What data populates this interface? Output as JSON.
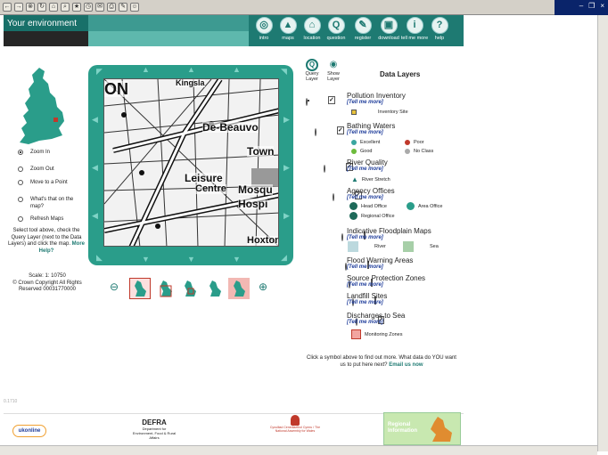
{
  "header": {
    "title": "Your environment"
  },
  "nav": [
    {
      "label": "intro",
      "icon": "intro-icon",
      "glyph": "◎"
    },
    {
      "label": "maps",
      "icon": "maps-icon",
      "glyph": "▲"
    },
    {
      "label": "location",
      "icon": "location-icon",
      "glyph": "⌂"
    },
    {
      "label": "question",
      "icon": "question-icon",
      "glyph": "Q"
    },
    {
      "label": "register",
      "icon": "register-icon",
      "glyph": "✎"
    },
    {
      "label": "download",
      "icon": "download-icon",
      "glyph": "▣"
    },
    {
      "label": "tell me more",
      "icon": "info-icon",
      "glyph": "i"
    },
    {
      "label": "help",
      "icon": "help-icon",
      "glyph": "?"
    }
  ],
  "tools": [
    {
      "label": "Zoom In",
      "selected": true
    },
    {
      "label": "Zoom Out",
      "selected": false
    },
    {
      "label": "Move to a Point",
      "selected": false
    },
    {
      "label": "What's that on the map?",
      "selected": false
    },
    {
      "label": "Refresh Maps",
      "selected": false
    }
  ],
  "hint": {
    "text": "Select tool above, check the Query Layer (next to the Data Layers) and click the map.",
    "link": "More Help?"
  },
  "scale": {
    "label": "Scale: 1: 10750",
    "copyright": "© Crown Copyright All Rights Reserved 00031770000"
  },
  "map": {
    "labels": [
      "ON",
      "Kingsla",
      "De-Beauvo",
      "Town",
      "Leisure",
      "Centre",
      "Mosqu",
      "Hospi",
      "Hoxton"
    ]
  },
  "data_layers": {
    "title": "Data Layers",
    "query_label": "Query Layer",
    "show_label": "Show Layer",
    "tell_more": "[Tell me more]",
    "layers": [
      {
        "name": "Pollution Inventory",
        "query": true,
        "show": true,
        "legend": [
          {
            "label": "Inventory Site",
            "color": "#e8c23a"
          }
        ]
      },
      {
        "name": "Bathing Waters",
        "query": false,
        "show": true,
        "legend": [
          {
            "label": "Excellent",
            "color": "#3aa6a0"
          },
          {
            "label": "Poor",
            "color": "#c0392b"
          },
          {
            "label": "Good",
            "color": "#6dbb3c"
          },
          {
            "label": "No Class",
            "color": "#aaaaaa"
          }
        ]
      },
      {
        "name": "River Quality",
        "query": false,
        "show": true,
        "legend": [
          {
            "label": "River Stretch",
            "color": "#1e7a72"
          }
        ]
      },
      {
        "name": "Agency Offices",
        "query": false,
        "show": true,
        "legend": [
          {
            "label": "Head Office",
            "color": "#1e6a5a"
          },
          {
            "label": "Area Office",
            "color": "#2a9d8a"
          },
          {
            "label": "Regional Office",
            "color": "#1e6a5a"
          }
        ]
      },
      {
        "name": "Indicative Floodplain Maps",
        "query": false,
        "show": false,
        "legend": [
          {
            "label": "River",
            "color": "#bcd9de"
          },
          {
            "label": "Sea",
            "color": "#a7cfa8"
          }
        ]
      },
      {
        "name": "Flood Warning Areas",
        "query": false,
        "show": false,
        "legend": []
      },
      {
        "name": "Source Protection Zones",
        "query": false,
        "show": false,
        "legend": []
      },
      {
        "name": "Landfill Sites",
        "query": false,
        "show": false,
        "legend": []
      },
      {
        "name": "Discharges to Sea",
        "query": false,
        "show": true,
        "legend": [
          {
            "label": "Monitoring Zones",
            "color": "#f2a5a0"
          }
        ]
      }
    ]
  },
  "footer": {
    "text": "Click a symbol above to find out more. What data do YOU want us to put here next?",
    "link": "Email us now",
    "number": "0.1710"
  },
  "logos": {
    "ukonline": "ukonline",
    "defra": "DEFRA",
    "defra_sub": "Department for Environment, Food & Rural Affairs",
    "nafw": "Cynulliad Cenedlaethol Cymru / The National Assembly for Wales",
    "regional": "Regional Information"
  }
}
